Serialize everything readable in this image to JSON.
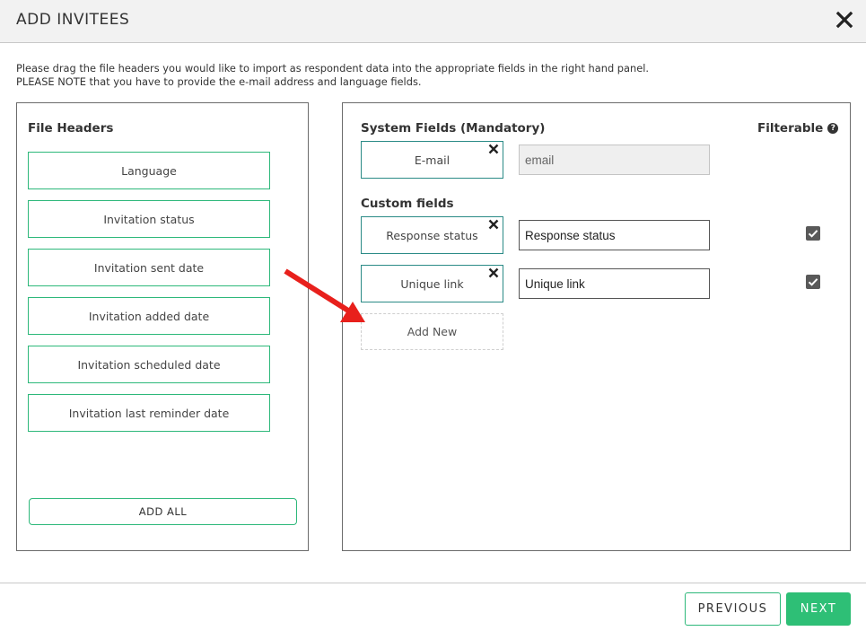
{
  "dialog": {
    "title": "ADD INVITEES",
    "close_icon": "close-icon"
  },
  "instructions": {
    "line1": "Please drag the file headers you would like to import as respondent data into the appropriate fields in the right hand panel.",
    "line2": "PLEASE NOTE that you have to provide the e-mail address and language fields."
  },
  "file_headers": {
    "heading": "File Headers",
    "items": [
      "Language",
      "Invitation status",
      "Invitation sent date",
      "Invitation added date",
      "Invitation scheduled date",
      "Invitation last reminder date"
    ],
    "add_all_label": "ADD ALL"
  },
  "system_fields": {
    "heading": "System Fields (Mandatory)",
    "filterable_label": "Filterable",
    "help_icon": "question-circle-icon",
    "fields": [
      {
        "tile": "E-mail",
        "value": "email",
        "disabled": true
      }
    ]
  },
  "custom_fields": {
    "heading": "Custom fields",
    "fields": [
      {
        "tile": "Response status",
        "value": "Response status",
        "filterable": true
      },
      {
        "tile": "Unique link",
        "value": "Unique link",
        "filterable": true
      }
    ],
    "add_new_label": "Add New"
  },
  "annotation": {
    "arrow_color": "#e8201c"
  },
  "footer": {
    "previous_label": "PREVIOUS",
    "next_label": "NEXT"
  },
  "colors": {
    "accent_green": "#2ebf76",
    "tile_border": "#2a8a86"
  }
}
